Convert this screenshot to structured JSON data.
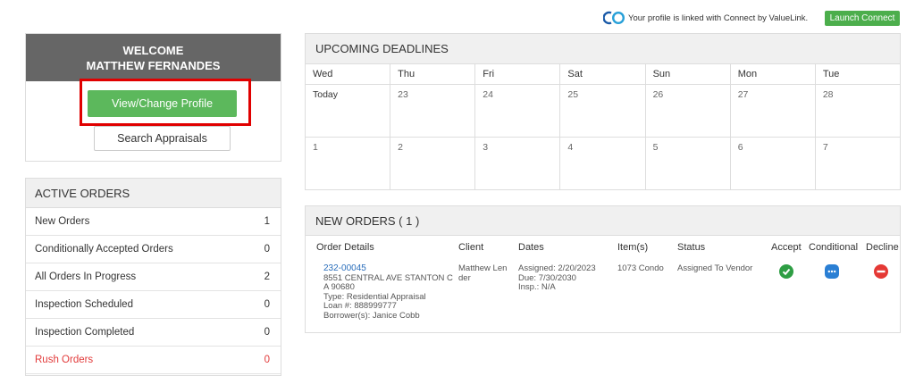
{
  "topbar": {
    "connect_text": "Your profile is linked with Connect by ValueLink.",
    "launch_label": "Launch Connect"
  },
  "welcome": {
    "line1": "WELCOME",
    "line2": "MATTHEW FERNANDES",
    "profile_button": "View/Change Profile",
    "search_button": "Search Appraisals"
  },
  "active_orders": {
    "title": "ACTIVE ORDERS",
    "items": [
      {
        "label": "New Orders",
        "count": "1"
      },
      {
        "label": "Conditionally Accepted Orders",
        "count": "0"
      },
      {
        "label": "All Orders In Progress",
        "count": "2"
      },
      {
        "label": "Inspection Scheduled",
        "count": "0"
      },
      {
        "label": "Inspection Completed",
        "count": "0"
      },
      {
        "label": "Rush Orders",
        "count": "0"
      }
    ]
  },
  "deadlines": {
    "title": "UPCOMING DEADLINES",
    "days": [
      "Wed",
      "Thu",
      "Fri",
      "Sat",
      "Sun",
      "Mon",
      "Tue"
    ],
    "week1": [
      "Today",
      "23",
      "24",
      "25",
      "26",
      "27",
      "28"
    ],
    "week2": [
      "1",
      "2",
      "3",
      "4",
      "5",
      "6",
      "7"
    ]
  },
  "new_orders": {
    "title": "NEW ORDERS ( 1 )",
    "columns": {
      "details": "Order Details",
      "client": "Client",
      "dates": "Dates",
      "items": "Item(s)",
      "status": "Status",
      "accept": "Accept",
      "conditional": "Conditional",
      "decline": "Decline"
    },
    "row": {
      "order_id": "232-00045",
      "address_1": "8551 CENTRAL AVE STANTON C",
      "address_2": "A 90680",
      "type": "Type: Residential Appraisal",
      "loan": "Loan #: 888999777",
      "borrower": "Borrower(s): Janice Cobb",
      "client_1": "Matthew Len",
      "client_2": "der",
      "assigned": "Assigned: 2/20/2023",
      "due": "Due: 7/30/2030",
      "insp": "Insp.: N/A",
      "items": "1073 Condo",
      "status": "Assigned To Vendor"
    }
  },
  "colors": {
    "accent_green": "#5cb85c",
    "header_gray": "#666666",
    "highlight_red": "#e00000",
    "link_blue": "#2a6ebb",
    "rush_red": "#e23b3b",
    "accept_icon": "#2e9e44",
    "conditional_icon": "#2a7fd4",
    "decline_icon": "#e53935"
  },
  "icons": [
    "connect-logo-icon",
    "check-circle-icon",
    "chat-bubble-icon",
    "minus-circle-icon"
  ]
}
